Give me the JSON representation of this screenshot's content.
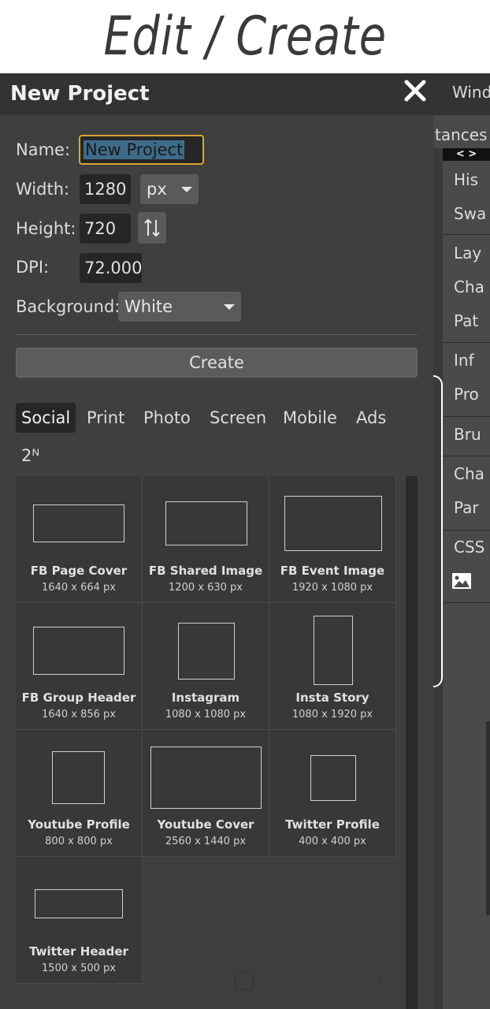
{
  "hero": {
    "title": "Edit / Create"
  },
  "side_panel": {
    "window_label": "Wind",
    "instances_label": "tances",
    "arrows": "< >",
    "items": [
      "His",
      "Swa",
      "Lay",
      "Cha",
      "Pat",
      "Inf",
      "Pro",
      "Bru",
      "Cha",
      "Par",
      "CSS"
    ],
    "image_icon": "image-icon"
  },
  "dialog": {
    "title": "New Project",
    "close_icon": "close-icon",
    "name": {
      "label": "Name:",
      "value": "New Project"
    },
    "width": {
      "label": "Width:",
      "value": "1280",
      "unit": "px"
    },
    "height": {
      "label": "Height:",
      "value": "720",
      "swap_icon": "swap-icon"
    },
    "dpi": {
      "label": "DPI:",
      "value": "72.000"
    },
    "background": {
      "label": "Background:",
      "value": "White"
    },
    "create_label": "Create",
    "tabs": [
      "Social",
      "Print",
      "Photo",
      "Screen",
      "Mobile",
      "Ads",
      "2ᴺ"
    ],
    "active_tab": "Social",
    "presets": [
      {
        "name": "FB Page Cover",
        "size": "1640 x 664 px"
      },
      {
        "name": "FB Shared Image",
        "size": "1200 x 630 px"
      },
      {
        "name": "FB Event Image",
        "size": "1920 x 1080 px"
      },
      {
        "name": "FB Group Header",
        "size": "1640 x 856 px"
      },
      {
        "name": "Instagram",
        "size": "1080 x 1080 px"
      },
      {
        "name": "Insta Story",
        "size": "1080 x 1920 px"
      },
      {
        "name": "Youtube Profile",
        "size": "800 x 800 px"
      },
      {
        "name": "Youtube Cover",
        "size": "2560 x 1440 px"
      },
      {
        "name": "Twitter Profile",
        "size": "400 x 400 px"
      },
      {
        "name": "Twitter Header",
        "size": "1500 x 500 px"
      }
    ]
  },
  "nav": {
    "recent_icon": "recent-apps-icon",
    "home_icon": "home-icon",
    "back_icon": "back-icon"
  },
  "colors": {
    "accent": "#d9a533",
    "selection": "#3f6b8a",
    "panel": "#3f3f3f"
  }
}
